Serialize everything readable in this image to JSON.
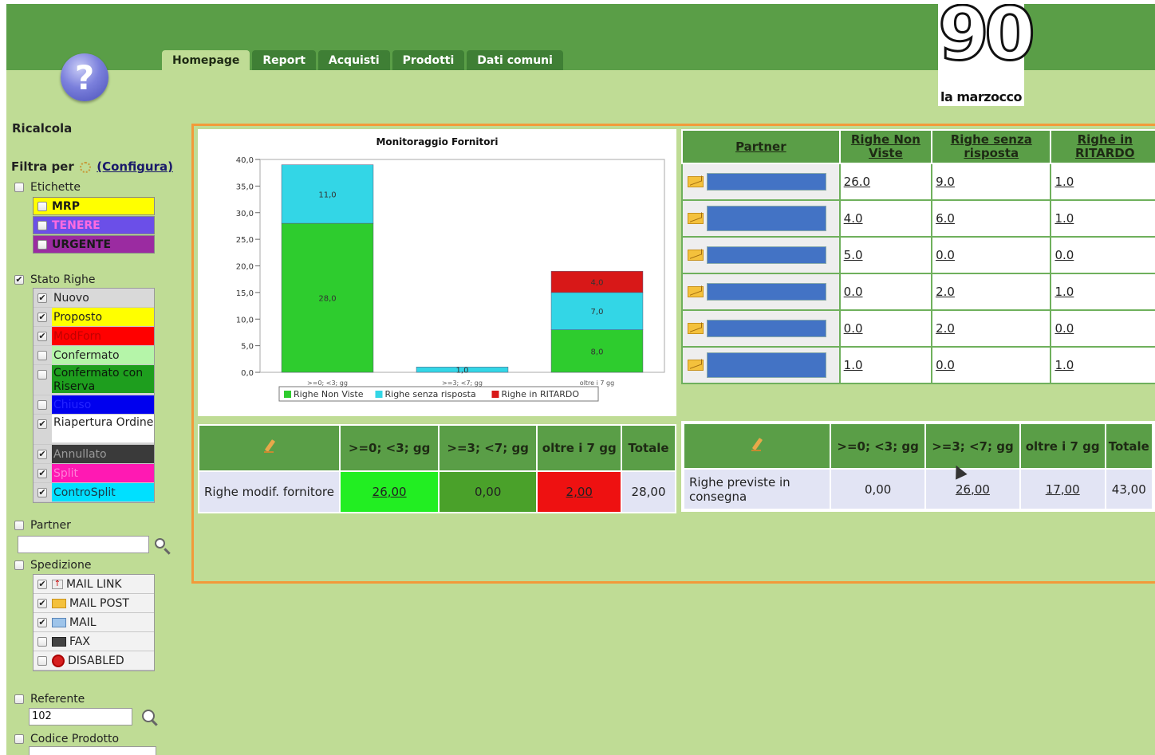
{
  "header": {
    "tabs": [
      "Homepage",
      "Report",
      "Acquisti",
      "Prodotti",
      "Dati comuni"
    ],
    "active_tab": "Homepage",
    "logo_number": "90",
    "logo_name": "la marzocco",
    "help_label": "?"
  },
  "sidebar": {
    "ricalcola": "Ricalcola",
    "filtra_per": "Filtra per",
    "configura": "(Configura)",
    "etichette": {
      "label": "Etichette",
      "items": [
        {
          "label": "MRP",
          "color": "#ffff00",
          "text_color": "#1a1a1a"
        },
        {
          "label": "TENERE",
          "color": "#6b4fe8",
          "text_color": "#ff6be0"
        },
        {
          "label": "URGENTE",
          "color": "#9b2ba1",
          "text_color": "#1a1a1a"
        }
      ]
    },
    "stato_righe": {
      "label": "Stato Righe",
      "checked": true,
      "items": [
        {
          "label": "Nuovo",
          "checked": true,
          "color": "#d9d9d9",
          "text_color": "#222"
        },
        {
          "label": "Proposto",
          "checked": true,
          "color": "#ffff00",
          "text_color": "#222"
        },
        {
          "label": "ModForn",
          "checked": true,
          "color": "#ff0000",
          "text_color": "#c00000"
        },
        {
          "label": "Confermato",
          "checked": false,
          "color": "#b5f5a9",
          "text_color": "#222"
        },
        {
          "label": "Confermato con Riserva",
          "checked": false,
          "color": "#1e9e1e",
          "text_color": "#0a1a0a",
          "tall": true
        },
        {
          "label": "Chiuso",
          "checked": false,
          "color": "#0000ee",
          "text_color": "#2323ff"
        },
        {
          "label": "Riapertura Ordine",
          "checked": true,
          "color": "#ffffff",
          "text_color": "#222",
          "tall": true
        },
        {
          "label": "Annullato",
          "checked": true,
          "color": "#3a3a3a",
          "text_color": "#9a9a9a"
        },
        {
          "label": "Split",
          "checked": true,
          "color": "#ff19b3",
          "text_color": "#ff7fd8"
        },
        {
          "label": "ControSplit",
          "checked": true,
          "color": "#00e0ff",
          "text_color": "#1a3a4a"
        }
      ]
    },
    "partner": {
      "label": "Partner",
      "value": ""
    },
    "spedizione": {
      "label": "Spedizione",
      "items": [
        {
          "label": "MAIL LINK",
          "checked": true,
          "icon": "mail-link-icon"
        },
        {
          "label": "MAIL POST",
          "checked": true,
          "icon": "mail-post-icon"
        },
        {
          "label": "MAIL",
          "checked": true,
          "icon": "mail-icon"
        },
        {
          "label": "FAX",
          "checked": false,
          "icon": "fax-icon"
        },
        {
          "label": "DISABLED",
          "checked": false,
          "icon": "disabled-icon"
        }
      ]
    },
    "referente": {
      "label": "Referente",
      "value": "102"
    },
    "codice_prodotto": {
      "label": "Codice Prodotto",
      "value": ""
    }
  },
  "chart_data": {
    "type": "bar",
    "title": "Monitoraggio Fornitori",
    "categories": [
      ">=0; <3; gg",
      ">=3; <7; gg",
      "oltre i 7 gg"
    ],
    "series": [
      {
        "name": "Righe Non Viste",
        "values": [
          28.0,
          0,
          8.0
        ],
        "color": "#2ecc2e"
      },
      {
        "name": "Righe senza risposta",
        "values": [
          11.0,
          1.0,
          7.0
        ],
        "color": "#33d6e6"
      },
      {
        "name": "Righe in RITARDO",
        "values": [
          0,
          0,
          4.0
        ],
        "color": "#d81818"
      }
    ],
    "stacked": true,
    "ylim": [
      0,
      40
    ],
    "yticks": [
      "0,0",
      "5,0",
      "10,0",
      "15,0",
      "20,0",
      "25,0",
      "30,0",
      "35,0",
      "40,0"
    ],
    "data_labels": [
      "28,0",
      "11,0",
      "1,0",
      "8,0",
      "7,0",
      "4,0"
    ],
    "legend": "bottom"
  },
  "partner_table": {
    "headers": [
      "Partner",
      "Righe Non Viste",
      "Righe senza risposta",
      "Righe in RITARDO"
    ],
    "rows": [
      [
        "26.0",
        "9.0",
        "1.0"
      ],
      [
        "4.0",
        "6.0",
        "1.0"
      ],
      [
        "5.0",
        "0.0",
        "0.0"
      ],
      [
        "0.0",
        "2.0",
        "1.0"
      ],
      [
        "0.0",
        "2.0",
        "0.0"
      ],
      [
        "1.0",
        "0.0",
        "1.0"
      ]
    ]
  },
  "stat_left": {
    "headers": [
      ">=0; <3; gg",
      ">=3; <7; gg",
      "oltre i 7 gg",
      "Totale"
    ],
    "row_label": "Righe modif. fornitore",
    "values": [
      "26,00",
      "0,00",
      "2,00",
      "28,00"
    ]
  },
  "stat_right": {
    "headers": [
      ">=0; <3; gg",
      ">=3; <7; gg",
      "oltre i 7 gg",
      "Totale"
    ],
    "row_label": "Righe previste in consegna",
    "values": [
      "0,00",
      "26,00",
      "17,00",
      "43,00"
    ]
  }
}
